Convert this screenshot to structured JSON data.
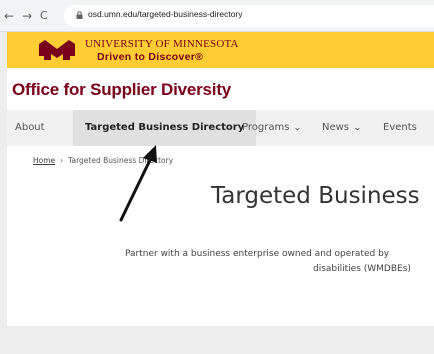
{
  "browser": {
    "back_glyph": "←",
    "forward_glyph": "→",
    "reload_glyph": "C",
    "url": "osd.umn.edu/targeted-business-directory"
  },
  "banner": {
    "university_name": "UNIVERSITY OF MINNESOTA",
    "tagline": "Driven to Discover®",
    "brand_maroon": "#7a0019",
    "brand_gold": "#ffcc33"
  },
  "site": {
    "title": "Office for Supplier Diversity"
  },
  "nav": {
    "items": [
      {
        "label": "About"
      },
      {
        "label": "Targeted Business Directory"
      },
      {
        "label": "Programs"
      },
      {
        "label": "News"
      },
      {
        "label": "Events"
      }
    ],
    "chevron": "⌄"
  },
  "breadcrumb": {
    "home": "Home",
    "separator": "›",
    "current": "Targeted Business Directory"
  },
  "main": {
    "heading": "Targeted Business",
    "intro_line1": "Partner with a business enterprise owned and operated by",
    "intro_line2": "disabilities (WMDBEs)"
  }
}
